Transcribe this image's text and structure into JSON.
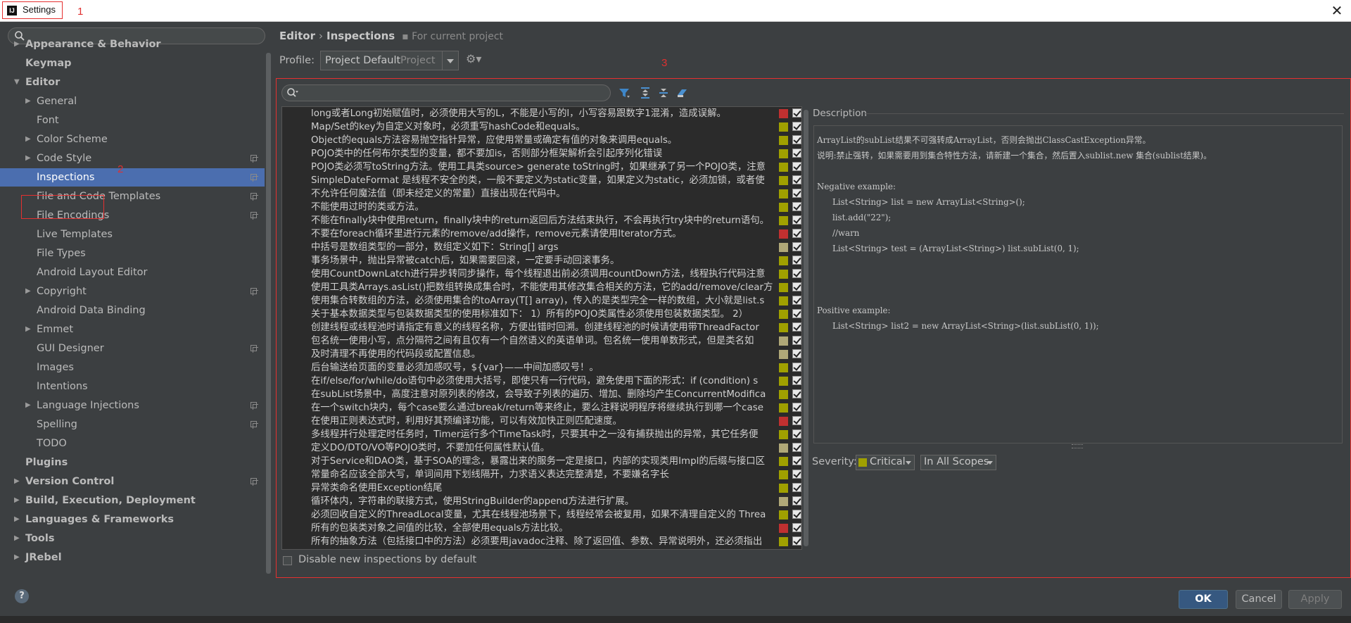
{
  "window": {
    "title": "Settings",
    "close_glyph": "✕"
  },
  "annotations": {
    "a1": "1",
    "a2": "2",
    "a3": "3"
  },
  "sidebar": {
    "items": [
      {
        "label": "Appearance & Behavior",
        "level": 0,
        "arrow": "right",
        "bold": true
      },
      {
        "label": "Keymap",
        "level": 0,
        "arrow": "",
        "bold": true
      },
      {
        "label": "Editor",
        "level": 0,
        "arrow": "down",
        "bold": true
      },
      {
        "label": "General",
        "level": 1,
        "arrow": "right"
      },
      {
        "label": "Font",
        "level": 1,
        "arrow": ""
      },
      {
        "label": "Color Scheme",
        "level": 1,
        "arrow": "right"
      },
      {
        "label": "Code Style",
        "level": 1,
        "arrow": "right",
        "page": true
      },
      {
        "label": "Inspections",
        "level": 1,
        "arrow": "",
        "page": true,
        "selected": true
      },
      {
        "label": "File and Code Templates",
        "level": 1,
        "arrow": "",
        "page": true
      },
      {
        "label": "File Encodings",
        "level": 1,
        "arrow": "",
        "page": true
      },
      {
        "label": "Live Templates",
        "level": 1,
        "arrow": ""
      },
      {
        "label": "File Types",
        "level": 1,
        "arrow": ""
      },
      {
        "label": "Android Layout Editor",
        "level": 1,
        "arrow": ""
      },
      {
        "label": "Copyright",
        "level": 1,
        "arrow": "right",
        "page": true
      },
      {
        "label": "Android Data Binding",
        "level": 1,
        "arrow": ""
      },
      {
        "label": "Emmet",
        "level": 1,
        "arrow": "right"
      },
      {
        "label": "GUI Designer",
        "level": 1,
        "arrow": "",
        "page": true
      },
      {
        "label": "Images",
        "level": 1,
        "arrow": ""
      },
      {
        "label": "Intentions",
        "level": 1,
        "arrow": ""
      },
      {
        "label": "Language Injections",
        "level": 1,
        "arrow": "right",
        "page": true
      },
      {
        "label": "Spelling",
        "level": 1,
        "arrow": "",
        "page": true
      },
      {
        "label": "TODO",
        "level": 1,
        "arrow": ""
      },
      {
        "label": "Plugins",
        "level": 0,
        "arrow": "",
        "bold": true
      },
      {
        "label": "Version Control",
        "level": 0,
        "arrow": "right",
        "bold": true,
        "page": true
      },
      {
        "label": "Build, Execution, Deployment",
        "level": 0,
        "arrow": "right",
        "bold": true
      },
      {
        "label": "Languages & Frameworks",
        "level": 0,
        "arrow": "right",
        "bold": true
      },
      {
        "label": "Tools",
        "level": 0,
        "arrow": "right",
        "bold": true
      },
      {
        "label": "JRebel",
        "level": 0,
        "arrow": "right",
        "bold": true
      }
    ]
  },
  "breadcrumb": {
    "section": "Editor",
    "separator": "›",
    "page": "Inspections",
    "scope_note": "For current project"
  },
  "profile": {
    "label": "Profile:",
    "value": "Project Default",
    "hint": "Project"
  },
  "inspections": {
    "rows": [
      {
        "text": "long或者Long初始赋值时，必须使用大写的L，不能是小写的l，小写容易跟数字1混淆，造成误解。",
        "severity": "red"
      },
      {
        "text": "Map/Set的key为自定义对象时，必须重写hashCode和equals。",
        "severity": "olive"
      },
      {
        "text": "Object的equals方法容易抛空指针异常，应使用常量或确定有值的对象来调用equals。",
        "severity": "olive"
      },
      {
        "text": "POJO类中的任何布尔类型的变量，都不要加is，否则部分框架解析会引起序列化错误",
        "severity": "olive"
      },
      {
        "text": "POJO类必须写toString方法。使用工具类source> generate toString时，如果继承了另一个POJO类，注意",
        "severity": "olive"
      },
      {
        "text": "SimpleDateFormat 是线程不安全的类，一般不要定义为static变量，如果定义为static，必须加锁，或者使",
        "severity": "olive"
      },
      {
        "text": "不允许任何魔法值（即未经定义的常量）直接出现在代码中。",
        "severity": "olive"
      },
      {
        "text": "不能使用过时的类或方法。",
        "severity": "olive"
      },
      {
        "text": "不能在finally块中使用return，finally块中的return返回后方法结束执行，不会再执行try块中的return语句。",
        "severity": "olive"
      },
      {
        "text": "不要在foreach循环里进行元素的remove/add操作，remove元素请使用Iterator方式。",
        "severity": "red"
      },
      {
        "text": "中括号是数组类型的一部分，数组定义如下：String[] args",
        "severity": "tan"
      },
      {
        "text": "事务场景中，抛出异常被catch后，如果需要回滚，一定要手动回滚事务。",
        "severity": "olive"
      },
      {
        "text": "使用CountDownLatch进行异步转同步操作，每个线程退出前必须调用countDown方法，线程执行代码注意",
        "severity": "olive"
      },
      {
        "text": "使用工具类Arrays.asList()把数组转换成集合时，不能使用其修改集合相关的方法，它的add/remove/clear方",
        "severity": "olive"
      },
      {
        "text": "使用集合转数组的方法，必须使用集合的toArray(T[] array)，传入的是类型完全一样的数组，大小就是list.s",
        "severity": "olive"
      },
      {
        "text": "关于基本数据类型与包装数据类型的使用标准如下： 1）所有的POJO类属性必须使用包装数据类型。 2）",
        "severity": "olive"
      },
      {
        "text": "创建线程或线程池时请指定有意义的线程名称，方便出错时回溯。创建线程池的时候请使用带ThreadFactor",
        "severity": "olive"
      },
      {
        "text": "包名统一使用小写，点分隔符之间有且仅有一个自然语义的英语单词。包名统一使用单数形式，但是类名如",
        "severity": "tan"
      },
      {
        "text": "及时清理不再使用的代码段或配置信息。",
        "severity": "tan"
      },
      {
        "text": "后台输送给页面的变量必须加感叹号，${var}——中间加感叹号！。",
        "severity": "olive"
      },
      {
        "text": "在if/else/for/while/do语句中必须使用大括号，即使只有一行代码，避免使用下面的形式：if (condition) s",
        "severity": "olive"
      },
      {
        "text": "在subList场景中，高度注意对原列表的修改，会导致子列表的遍历、增加、删除均产生ConcurrentModifica",
        "severity": "olive"
      },
      {
        "text": "在一个switch块内，每个case要么通过break/return等来终止，要么注释说明程序将继续执行到哪一个case",
        "severity": "olive"
      },
      {
        "text": "在使用正则表达式时，利用好其预编译功能，可以有效加快正则匹配速度。",
        "severity": "red"
      },
      {
        "text": "多线程并行处理定时任务时，Timer运行多个TimeTask时，只要其中之一没有捕获抛出的异常，其它任务便",
        "severity": "olive"
      },
      {
        "text": "定义DO/DTO/VO等POJO类时，不要加任何属性默认值。",
        "severity": "tan"
      },
      {
        "text": "对于Service和DAO类，基于SOA的理念，暴露出来的服务一定是接口，内部的实现类用Impl的后缀与接口区",
        "severity": "olive"
      },
      {
        "text": "常量命名应该全部大写，单词间用下划线隔开，力求语义表达完整清楚，不要嫌名字长",
        "severity": "olive"
      },
      {
        "text": "异常类命名使用Exception结尾",
        "severity": "olive"
      },
      {
        "text": "循环体内，字符串的联接方式，使用StringBuilder的append方法进行扩展。",
        "severity": "tan"
      },
      {
        "text": "必须回收自定义的ThreadLocal变量，尤其在线程池场景下，线程经常会被复用，如果不清理自定义的 Threa",
        "severity": "olive"
      },
      {
        "text": "所有的包装类对象之间值的比较，全部使用equals方法比较。",
        "severity": "red"
      },
      {
        "text": "所有的抽象方法（包括接口中的方法）必须要用javadoc注释、除了返回值、参数、异常说明外，还必须指出",
        "severity": "olive"
      }
    ],
    "disable_label": "Disable new inspections by default"
  },
  "description": {
    "label": "Description",
    "line1": "ArrayList的subList结果不可强转成ArrayList，否则会抛出ClassCastException异常。",
    "line2": "说明:禁止强转，如果需要用到集合特性方法，请新建一个集合，然后置入sublist.new 集合(sublist结果)。",
    "neg_title": "Negative example:",
    "neg_1": "List<String> list = new ArrayList<String>();",
    "neg_2": "list.add(\"22\");",
    "neg_3": "//warn",
    "neg_4": "List<String> test = (ArrayList<String>) list.subList(0, 1);",
    "pos_title": "Positive example:",
    "pos_1": "List<String> list2 = new ArrayList<String>(list.subList(0, 1));"
  },
  "severity": {
    "label": "Severity:",
    "value": "Critical",
    "scope": "In All Scopes"
  },
  "buttons": {
    "ok": "OK",
    "cancel": "Cancel",
    "apply": "Apply",
    "help": "?"
  },
  "colors": {
    "red": "#c03030",
    "olive": "#a0a000",
    "tan": "#b0a878",
    "selection": "#4b6eaf",
    "annotation": "#e53030"
  },
  "icons": [
    "search-icon",
    "gear-icon",
    "filter-icon",
    "expand-all-icon",
    "collapse-all-icon",
    "reset-icon",
    "close-icon",
    "help-icon"
  ]
}
